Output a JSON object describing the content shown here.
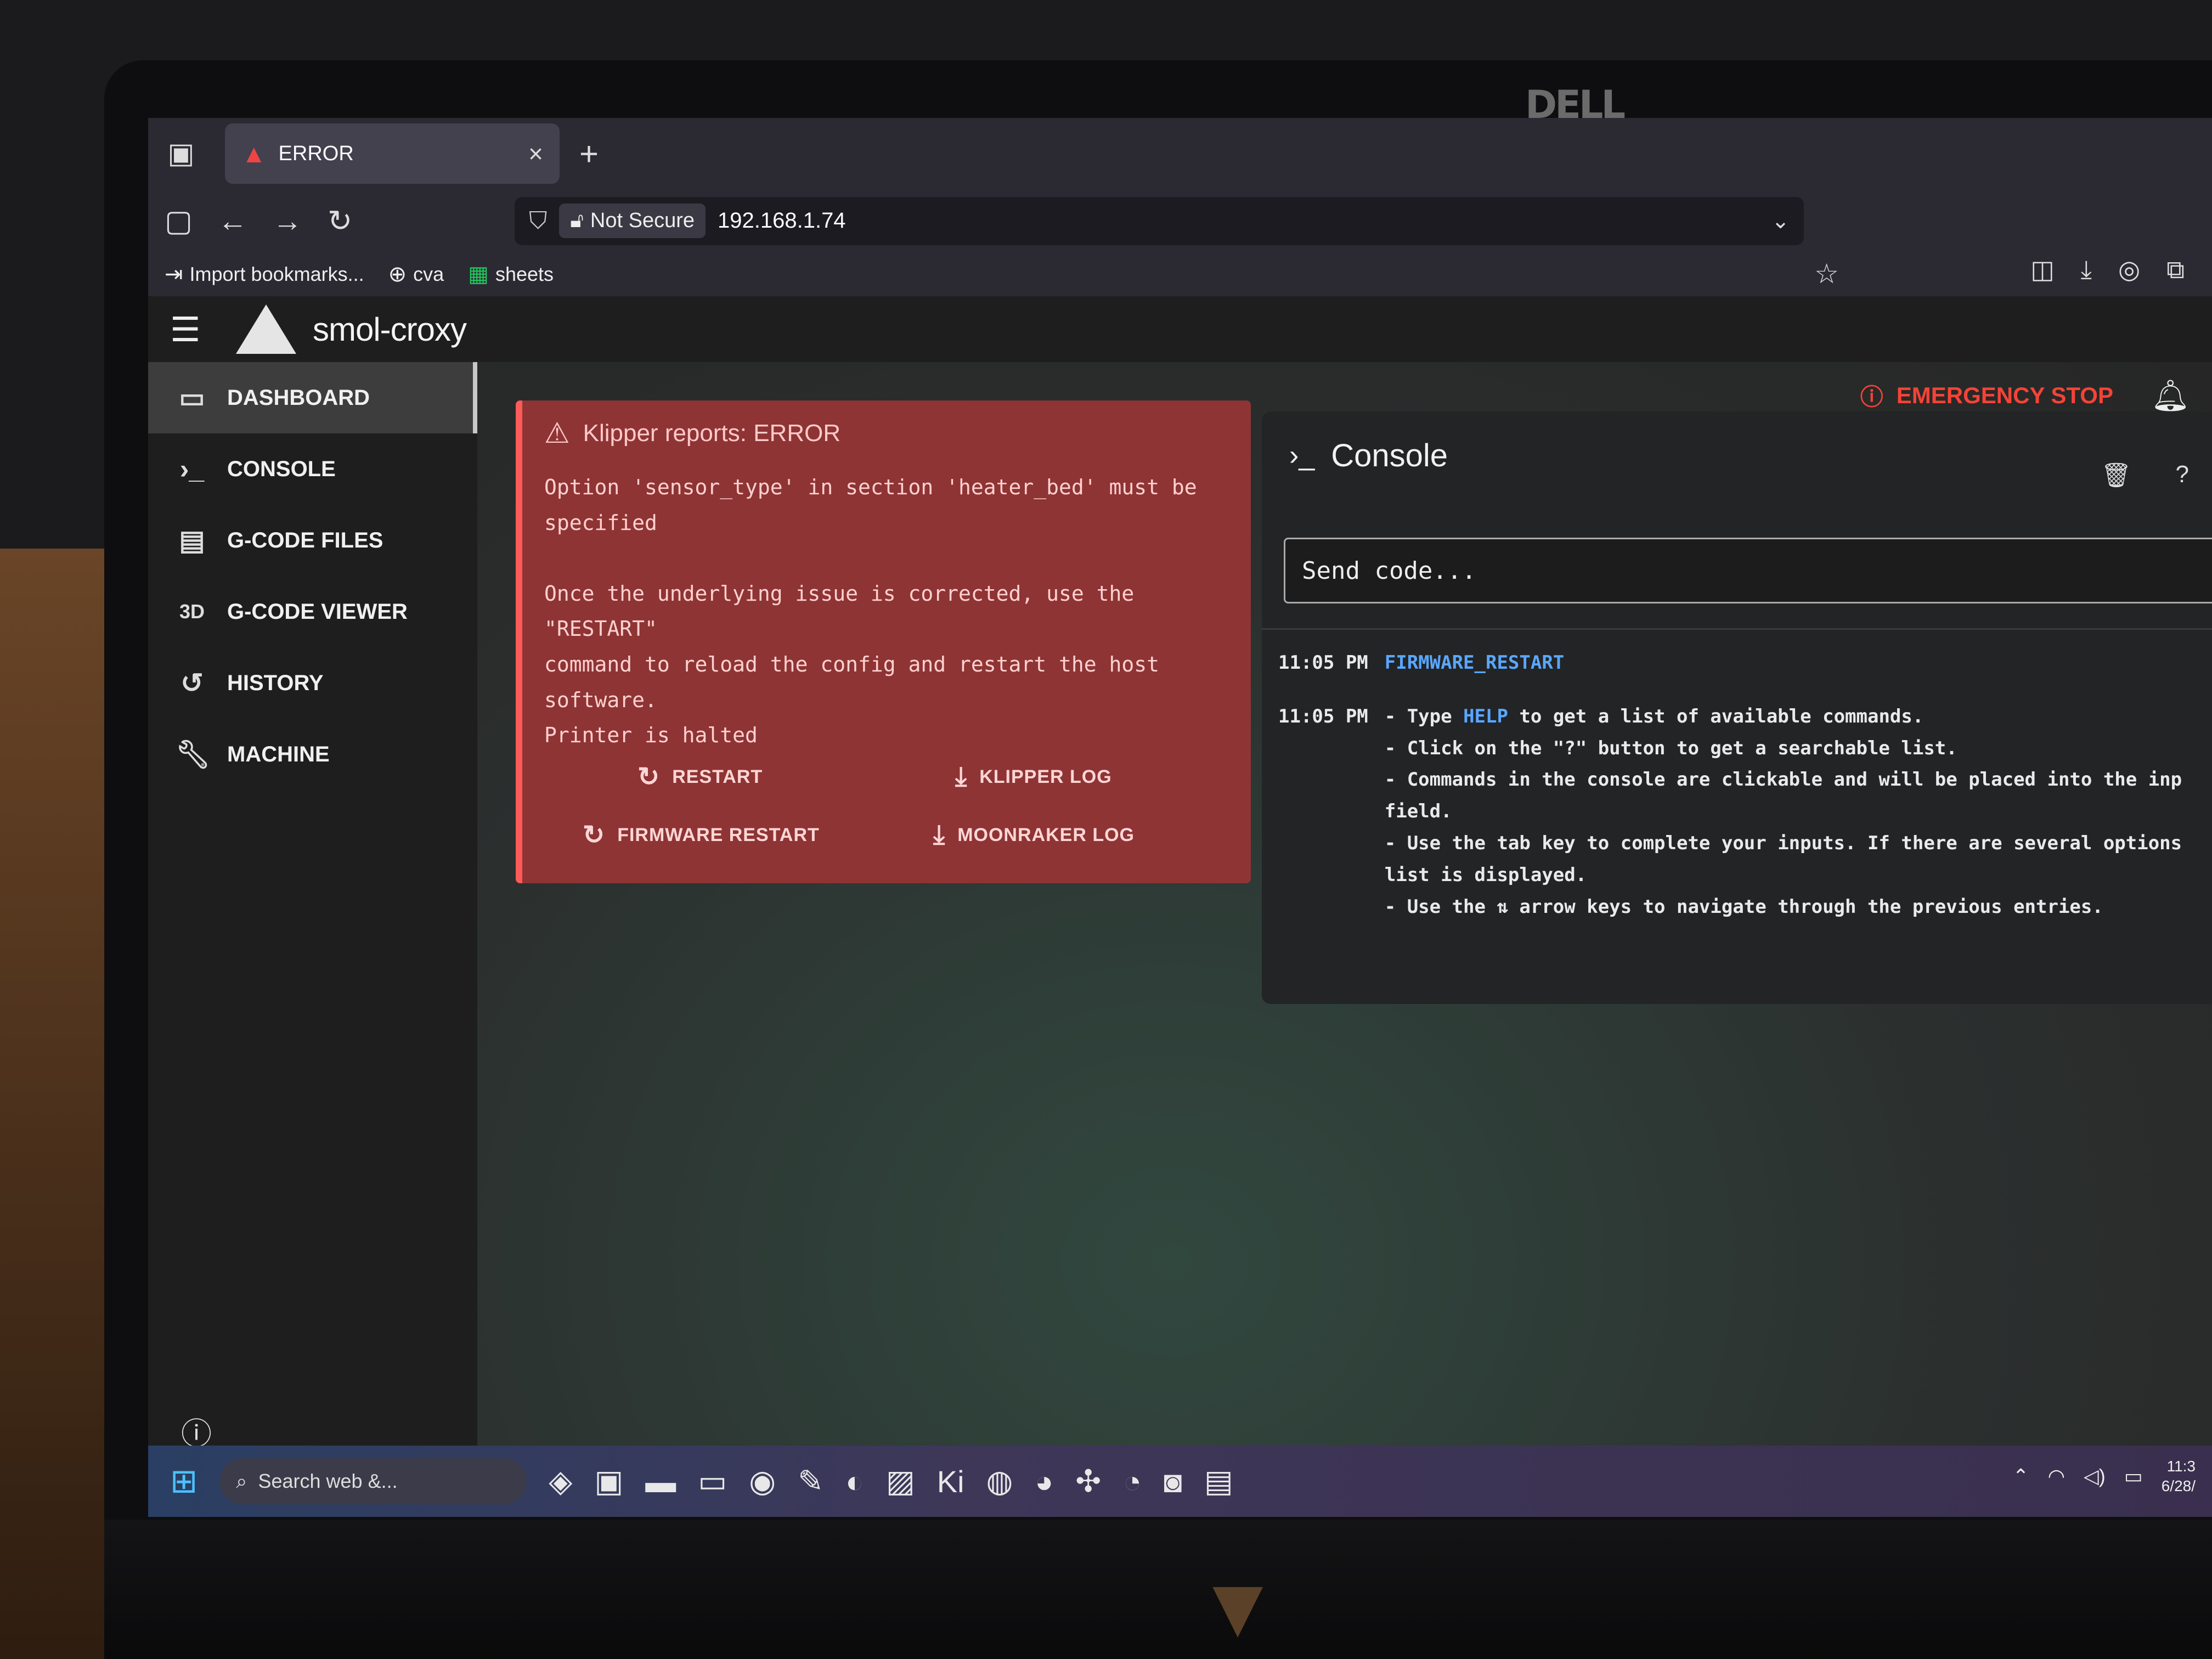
{
  "browser": {
    "tab_title": "ERROR",
    "tab_close": "×",
    "new_tab": "+",
    "security_label": "Not Secure",
    "url": "192.168.1.74",
    "bookmarks": [
      {
        "icon": "import-icon",
        "label": "Import bookmarks..."
      },
      {
        "icon": "globe-icon",
        "label": "cva"
      },
      {
        "icon": "sheets-icon",
        "label": "sheets"
      }
    ]
  },
  "app": {
    "title": "smol-croxy",
    "emergency_stop": "EMERGENCY STOP",
    "nav": [
      {
        "icon": "monitor-icon",
        "label": "DASHBOARD",
        "active": true
      },
      {
        "icon": "console-icon",
        "label": "CONSOLE"
      },
      {
        "icon": "file-icon",
        "label": "G-CODE FILES"
      },
      {
        "icon": "3d-icon",
        "label": "G-CODE VIEWER"
      },
      {
        "icon": "history-icon",
        "label": "HISTORY"
      },
      {
        "icon": "wrench-icon",
        "label": "MACHINE"
      }
    ]
  },
  "error_panel": {
    "title": "Klipper reports: ERROR",
    "message": "Option 'sensor_type' in section 'heater_bed' must be\nspecified\n\nOnce the underlying issue is corrected, use the\n\"RESTART\"\ncommand to reload the config and restart the host\nsoftware.\nPrinter is halted",
    "buttons": {
      "restart": "RESTART",
      "klipper_log": "KLIPPER LOG",
      "firmware_restart": "FIRMWARE RESTART",
      "moonraker_log": "MOONRAKER LOG"
    }
  },
  "console": {
    "title": "Console",
    "input_placeholder": "Send code...",
    "entries": [
      {
        "time": "11:05 PM",
        "command": "FIRMWARE_RESTART"
      },
      {
        "time": "11:05 PM",
        "line1_pre": "- Type ",
        "line1_link": "HELP",
        "line1_post": " to get a list of available commands.",
        "lines": [
          "- Click on the \"?\" button to get a searchable list.",
          "- Commands in the console are clickable and will be placed into the inp",
          "field.",
          "- Use the tab key to complete your inputs. If there are several options",
          "list is displayed.",
          "- Use the ⇅ arrow keys to navigate through the previous entries."
        ]
      }
    ]
  },
  "taskbar": {
    "search_placeholder": "Search web &...",
    "clock_time": "11:3",
    "clock_date": "6/28/"
  },
  "bezel": {
    "brand": "DELL"
  },
  "colors": {
    "error_bg": "#8e3434",
    "error_border": "#ff5a5a",
    "emergency": "#f44336",
    "link": "#5aa7ff"
  }
}
